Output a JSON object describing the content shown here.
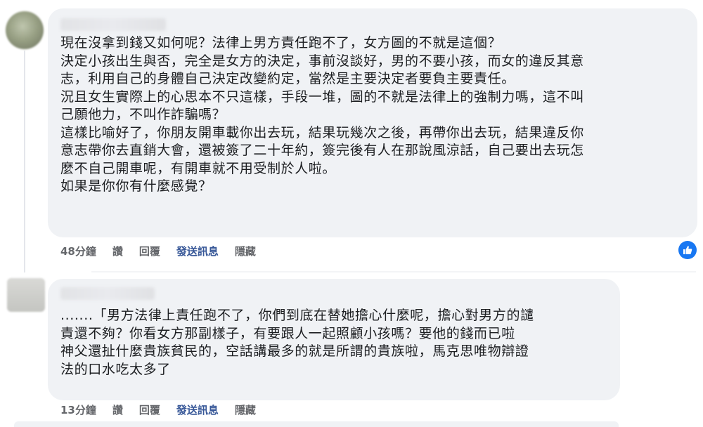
{
  "comments": [
    {
      "author": "",
      "text": "現在沒拿到錢又如何呢？法律上男方責任跑不了，女方圖的不就是這個？\n決定小孩出生與否，完全是女方的決定，事前沒談好，男的不要小孩，而女的違反其意\n志，利用自己的身體自己決定改變約定，當然是主要決定者要負主要責任。\n況且女生實際上的心思本不只這樣，手段一堆，圖的不就是法律上的強制力嗎，這不叫\n己願他力，不叫作詐騙嗎？\n這樣比喻好了，你朋友開車載你出去玩，結果玩幾次之後，再帶你出去玩，結果違反你\n意志帶你去直銷大會，還被簽了二十年約，簽完後有人在那說風涼話，自己要出去玩怎\n麼不自己開車呢，有開車就不用受制於人啦。\n如果是你你有什麼感覺？",
      "time": "48分鐘",
      "like_label": "讚",
      "reply_label": "回覆",
      "send_message_label": "發送訊息",
      "hide_label": "隱藏"
    },
    {
      "author": "",
      "text": ".......「男方法律上責任跑不了，你們到底在替她擔心什麼呢，擔心對男方的譴\n責還不夠？你看女方那副樣子，有要跟人一起照顧小孩嗎？要他的錢而已啦\n神父還扯什麼貴族貧民的，空話講最多的就是所謂的貴族啦，馬克思唯物辯證\n法的口水吃太多了",
      "time": "13分鐘",
      "like_label": "讚",
      "reply_label": "回覆",
      "send_message_label": "發送訊息",
      "hide_label": "隱藏"
    }
  ],
  "reaction": {
    "icon": "thumbs-up-icon",
    "color": "#1877f2"
  },
  "colors": {
    "bubble": "#f0f2f5",
    "meta_text": "#65676b",
    "link": "#385898"
  }
}
